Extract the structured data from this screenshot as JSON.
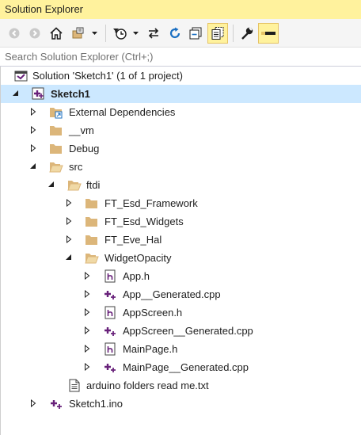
{
  "window": {
    "title": "Solution Explorer"
  },
  "toolbar": {
    "icons": [
      "back-icon",
      "forward-icon",
      "home-icon",
      "switch-views-icon",
      "dropdown-arrow-icon",
      "pending-changes-filter-icon",
      "dropdown-arrow-icon",
      "sync-with-active-document-icon",
      "refresh-icon",
      "collapse-all-icon",
      "show-all-files-icon",
      "properties-icon",
      "preview-selected-items-icon"
    ]
  },
  "search": {
    "placeholder": "Search Solution Explorer (Ctrl+;)",
    "value": ""
  },
  "tree": {
    "solution": "Solution 'Sketch1' (1 of 1 project)",
    "project": "Sketch1",
    "items": [
      "External Dependencies",
      "__vm",
      "Debug",
      "src",
      "ftdi",
      "FT_Esd_Framework",
      "FT_Esd_Widgets",
      "FT_Eve_Hal",
      "WidgetOpacity",
      "App.h",
      "App__Generated.cpp",
      "AppScreen.h",
      "AppScreen__Generated.cpp",
      "MainPage.h",
      "MainPage__Generated.cpp",
      "arduino folders read me.txt",
      "Sketch1.ino"
    ]
  },
  "colors": {
    "title_bg": "#fff29d",
    "selection_bg": "#cce8ff",
    "folder": "#dcb67a",
    "cpp_purple": "#68217a"
  }
}
